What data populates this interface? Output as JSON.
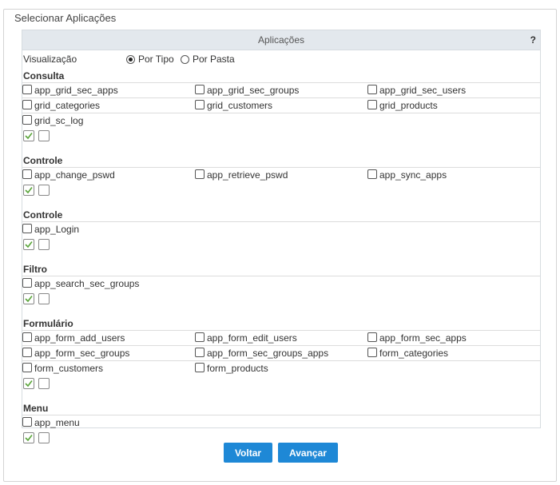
{
  "fieldset": {
    "legend": "Selecionar Aplicações"
  },
  "panel": {
    "title": "Aplicações",
    "help": "?",
    "visualizacao_label": "Visualização",
    "radio_tipo": "Por Tipo",
    "radio_pasta": "Por Pasta",
    "selected_view": "Por Tipo"
  },
  "sections": [
    {
      "title": "Consulta",
      "rows": [
        [
          "app_grid_sec_apps",
          "app_grid_sec_groups",
          "app_grid_sec_users"
        ],
        [
          "grid_categories",
          "grid_customers",
          "grid_products"
        ],
        [
          "grid_sc_log"
        ]
      ]
    },
    {
      "title": "Controle",
      "rows": [
        [
          "app_change_pswd",
          "app_retrieve_pswd",
          "app_sync_apps"
        ]
      ]
    },
    {
      "title": "Controle",
      "rows": [
        [
          "app_Login"
        ]
      ]
    },
    {
      "title": "Filtro",
      "rows": [
        [
          "app_search_sec_groups"
        ]
      ]
    },
    {
      "title": "Formulário",
      "rows": [
        [
          "app_form_add_users",
          "app_form_edit_users",
          "app_form_sec_apps"
        ],
        [
          "app_form_sec_groups",
          "app_form_sec_groups_apps",
          "form_categories"
        ],
        [
          "form_customers",
          "form_products"
        ]
      ]
    },
    {
      "title": "Menu",
      "rows": [
        [
          "app_menu"
        ]
      ]
    }
  ],
  "buttons": {
    "voltar": "Voltar",
    "avancar": "Avançar"
  },
  "colors": {
    "button": "#1e88d6",
    "header": "#e3e8ed",
    "check": "#5aa53a"
  }
}
